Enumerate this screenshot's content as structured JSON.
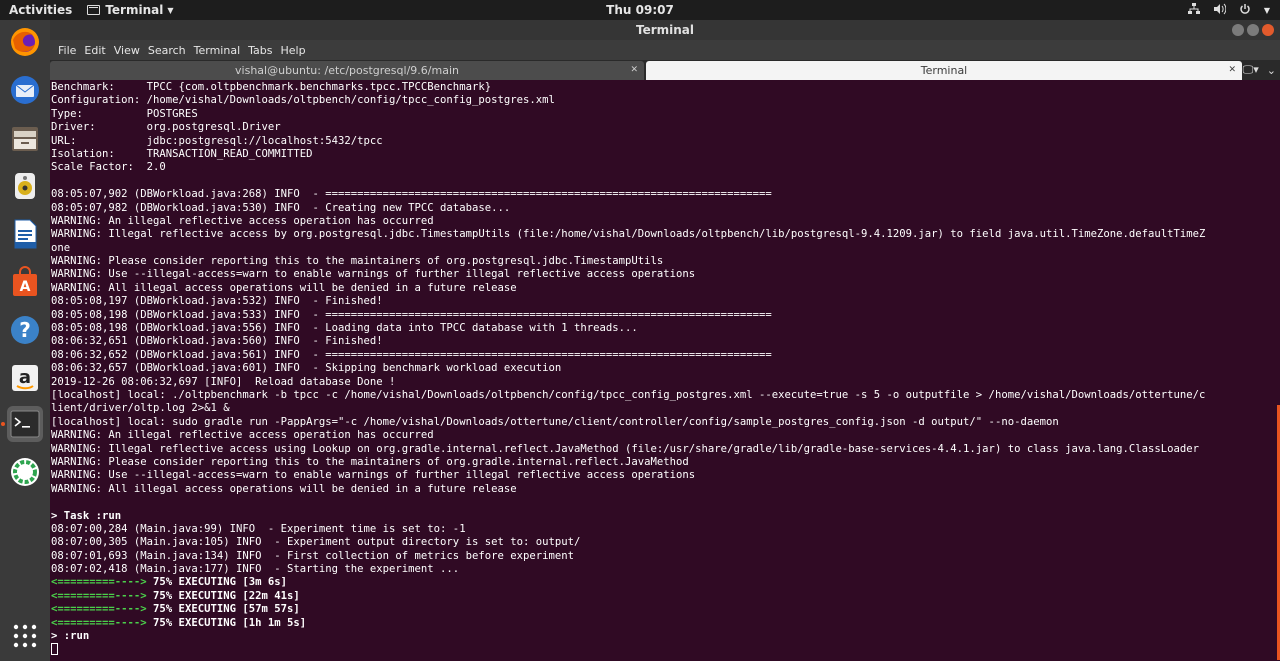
{
  "topbar": {
    "activities": "Activities",
    "app_name": "Terminal",
    "clock": "Thu 09:07"
  },
  "window": {
    "title": "Terminal"
  },
  "menubar": [
    "File",
    "Edit",
    "View",
    "Search",
    "Terminal",
    "Tabs",
    "Help"
  ],
  "tabs": [
    {
      "label": "vishal@ubuntu: /etc/postgresql/9.6/main",
      "active": false
    },
    {
      "label": "Terminal",
      "active": true
    }
  ],
  "dock": [
    {
      "name": "firefox-icon",
      "color": "#e66000"
    },
    {
      "name": "thunderbird-icon",
      "color": "#2a6ed0"
    },
    {
      "name": "files-icon",
      "color": "#9c8a75"
    },
    {
      "name": "rhythmbox-icon",
      "color": "#d8b01c"
    },
    {
      "name": "writer-icon",
      "color": "#1f5ea8"
    },
    {
      "name": "software-center-icon",
      "color": "#e95420"
    },
    {
      "name": "help-icon",
      "color": "#3b82c8"
    },
    {
      "name": "amazon-icon",
      "color": "#ffffff"
    },
    {
      "name": "terminal-icon",
      "color": "#2b2b2b"
    },
    {
      "name": "app-icon",
      "color": "#2ea44f"
    }
  ],
  "terminal": {
    "lines": [
      "Benchmark:     TPCC {com.oltpbenchmark.benchmarks.tpcc.TPCCBenchmark}",
      "Configuration: /home/vishal/Downloads/oltpbench/config/tpcc_config_postgres.xml",
      "Type:          POSTGRES",
      "Driver:        org.postgresql.Driver",
      "URL:           jdbc:postgresql://localhost:5432/tpcc",
      "Isolation:     TRANSACTION_READ_COMMITTED",
      "Scale Factor:  2.0",
      "",
      "08:05:07,902 (DBWorkload.java:268) INFO  - ======================================================================",
      "08:05:07,982 (DBWorkload.java:530) INFO  - Creating new TPCC database...",
      "WARNING: An illegal reflective access operation has occurred",
      "WARNING: Illegal reflective access by org.postgresql.jdbc.TimestampUtils (file:/home/vishal/Downloads/oltpbench/lib/postgresql-9.4.1209.jar) to field java.util.TimeZone.defaultTimeZ",
      "one",
      "WARNING: Please consider reporting this to the maintainers of org.postgresql.jdbc.TimestampUtils",
      "WARNING: Use --illegal-access=warn to enable warnings of further illegal reflective access operations",
      "WARNING: All illegal access operations will be denied in a future release",
      "08:05:08,197 (DBWorkload.java:532) INFO  - Finished!",
      "08:05:08,198 (DBWorkload.java:533) INFO  - ======================================================================",
      "08:05:08,198 (DBWorkload.java:556) INFO  - Loading data into TPCC database with 1 threads...",
      "08:06:32,651 (DBWorkload.java:560) INFO  - Finished!",
      "08:06:32,652 (DBWorkload.java:561) INFO  - ======================================================================",
      "08:06:32,657 (DBWorkload.java:601) INFO  - Skipping benchmark workload execution",
      "2019-12-26 08:06:32,697 [INFO]  Reload database Done !",
      "[localhost] local: ./oltpbenchmark -b tpcc -c /home/vishal/Downloads/oltpbench/config/tpcc_config_postgres.xml --execute=true -s 5 -o outputfile > /home/vishal/Downloads/ottertune/c",
      "lient/driver/oltp.log 2>&1 &",
      "[localhost] local: sudo gradle run -PappArgs=\"-c /home/vishal/Downloads/ottertune/client/controller/config/sample_postgres_config.json -d output/\" --no-daemon",
      "WARNING: An illegal reflective access operation has occurred",
      "WARNING: Illegal reflective access using Lookup on org.gradle.internal.reflect.JavaMethod (file:/usr/share/gradle/lib/gradle-base-services-4.4.1.jar) to class java.lang.ClassLoader",
      "WARNING: Please consider reporting this to the maintainers of org.gradle.internal.reflect.JavaMethod",
      "WARNING: Use --illegal-access=warn to enable warnings of further illegal reflective access operations",
      "WARNING: All illegal access operations will be denied in a future release",
      "",
      "> Task :run",
      "08:07:00,284 (Main.java:99) INFO  - Experiment time is set to: -1",
      "08:07:00,305 (Main.java:105) INFO  - Experiment output directory is set to: output/",
      "08:07:01,693 (Main.java:134) INFO  - First collection of metrics before experiment",
      "08:07:02,418 (Main.java:177) INFO  - Starting the experiment ..."
    ],
    "progress": [
      {
        "bar": "<=========---->",
        "text": " 75% EXECUTING [3m 6s]"
      },
      {
        "bar": "<=========---->",
        "text": " 75% EXECUTING [22m 41s]"
      },
      {
        "bar": "<=========---->",
        "text": " 75% EXECUTING [57m 57s]"
      },
      {
        "bar": "<=========---->",
        "text": " 75% EXECUTING [1h 1m 5s]"
      }
    ],
    "last_line": "> :run"
  }
}
